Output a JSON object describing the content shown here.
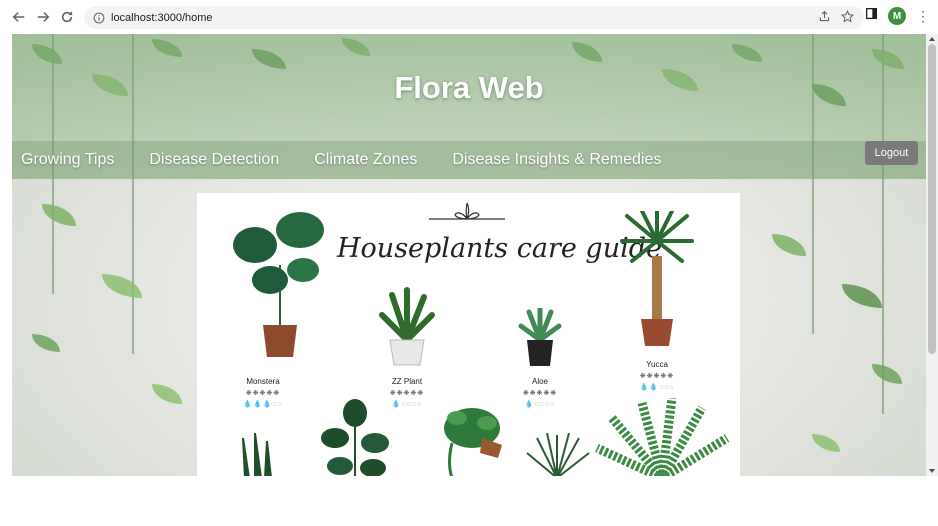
{
  "browser": {
    "url": "localhost:3000/home",
    "profile_initial": "M"
  },
  "site": {
    "title": "Flora Web",
    "nav": [
      "Growing Tips",
      "Disease Detection",
      "Climate Zones",
      "Disease Insights & Remedies"
    ],
    "logout_label": "Logout"
  },
  "guide": {
    "title": "Houseplants care guide",
    "plants": [
      {
        "name": "Monstera",
        "sun": "❋❋❋❋❋",
        "water": "💧💧💧◌◌"
      },
      {
        "name": "ZZ Plant",
        "sun": "❋❋❋❋❋",
        "water": "💧◌◌◌◌"
      },
      {
        "name": "Aloe",
        "sun": "❋❋❋❋❋",
        "water": "💧◌◌◌◌"
      },
      {
        "name": "Yucca",
        "sun": "❋❋❋❋❋",
        "water": "💧💧◌◌◌"
      }
    ]
  },
  "colors": {
    "accent_green": "#3e8e3e",
    "logout_bg": "#7a7a7a"
  }
}
